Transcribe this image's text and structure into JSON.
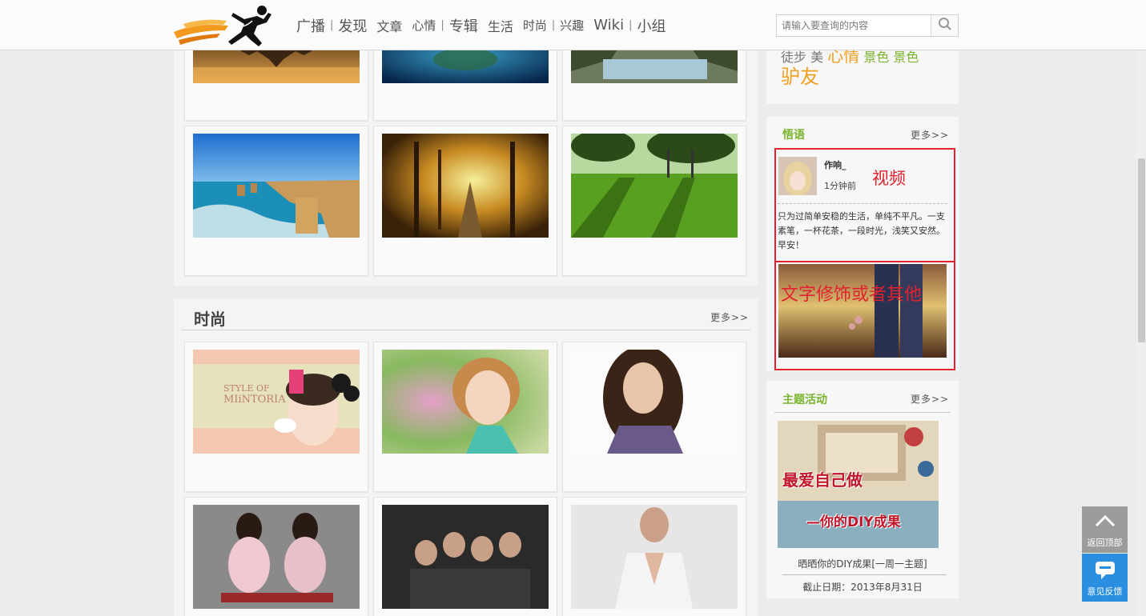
{
  "nav": {
    "items": [
      {
        "label": "广播",
        "size": 18
      },
      {
        "label": "发现",
        "size": 18
      },
      {
        "label": "文章",
        "size": 16
      },
      {
        "label": "心情",
        "size": 15
      },
      {
        "label": "专辑",
        "size": 18
      },
      {
        "label": "生活",
        "size": 16
      },
      {
        "label": "时尚",
        "size": 15
      },
      {
        "label": "兴趣",
        "size": 15
      },
      {
        "label": "Wiki",
        "size": 18
      },
      {
        "label": "小组",
        "size": 18
      }
    ],
    "separator": "|"
  },
  "search": {
    "placeholder": "请输入要查询的内容"
  },
  "sections": {
    "fashion": {
      "title": "时尚",
      "more": "更多>>"
    }
  },
  "sidebar": {
    "tags": [
      "徒步",
      "美",
      "心情",
      "景色",
      "景色",
      "驴友"
    ],
    "wuyu": {
      "title": "悟语",
      "more": "更多>>",
      "author": "作响_",
      "time": "1分钟前",
      "text": "只为过简单安稳的生活，单纯不平凡。一支素笔，一杯花茶，一段时光，浅笑又安然。早安！",
      "annotation_video": "视频",
      "annotation_text": "文字修饰或者其他"
    },
    "activity": {
      "title": "主题活动",
      "more": "更多>>",
      "poster_line1": "最爱自己做",
      "poster_line2": "—你的DIY成果",
      "caption": "晒晒你的DIY成果[一周一主题]",
      "deadline": "截止日期：2013年8月31日"
    }
  },
  "float_buttons": {
    "top": "返回顶部",
    "feedback": "意见反馈"
  },
  "colors": {
    "accent_green": "#7ab32d",
    "annotation_red": "#e0232f",
    "float_gray": "#9c9c9c",
    "float_blue": "#2a8fe0"
  }
}
